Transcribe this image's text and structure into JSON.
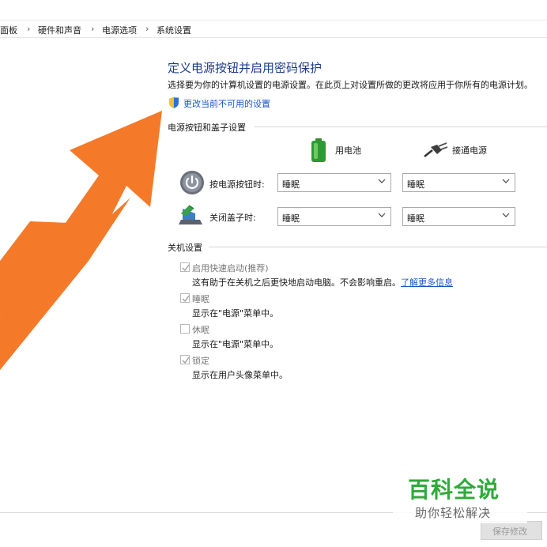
{
  "breadcrumb": {
    "items": [
      "面板",
      "硬件和声音",
      "电源选项",
      "系统设置"
    ],
    "separator": "›"
  },
  "page": {
    "title": "定义电源按钮并启用密码保护",
    "description": "选择要为你的计算机设置的电源设置。在此页上对设置所做的更改将应用于你所有的电源计划。",
    "change_link": "更改当前不可用的设置"
  },
  "power_buttons": {
    "section_title": "电源按钮和盖子设置",
    "col_battery": "用电池",
    "col_plugged": "接通电源",
    "rows": [
      {
        "label": "按电源按钮时:",
        "battery_value": "睡眠",
        "plugged_value": "睡眠",
        "icon": "power-button-icon"
      },
      {
        "label": "关闭盖子时:",
        "battery_value": "睡眠",
        "plugged_value": "睡眠",
        "icon": "laptop-lid-icon"
      }
    ]
  },
  "shutdown": {
    "section_title": "关机设置",
    "items": [
      {
        "label": "启用快速启动(推荐)",
        "checked": true,
        "desc": "这有助于在关机之后更快地启动电脑。不会影响重启。",
        "link": "了解更多信息"
      },
      {
        "label": "睡眠",
        "checked": true,
        "desc": "显示在\"电源\"菜单中。"
      },
      {
        "label": "休眠",
        "checked": false,
        "desc": "显示在\"电源\"菜单中。"
      },
      {
        "label": "锁定",
        "checked": true,
        "desc": "显示在用户头像菜单中。"
      }
    ]
  },
  "footer": {
    "save_label": "保存修改"
  },
  "watermark": {
    "title": "百科全说",
    "subtitle": "助你轻松解决"
  },
  "colors": {
    "accent_arrow": "#f47a2a",
    "link": "#1a56c6",
    "title": "#1e3c8c",
    "watermark_green": "#2eaa3a"
  }
}
